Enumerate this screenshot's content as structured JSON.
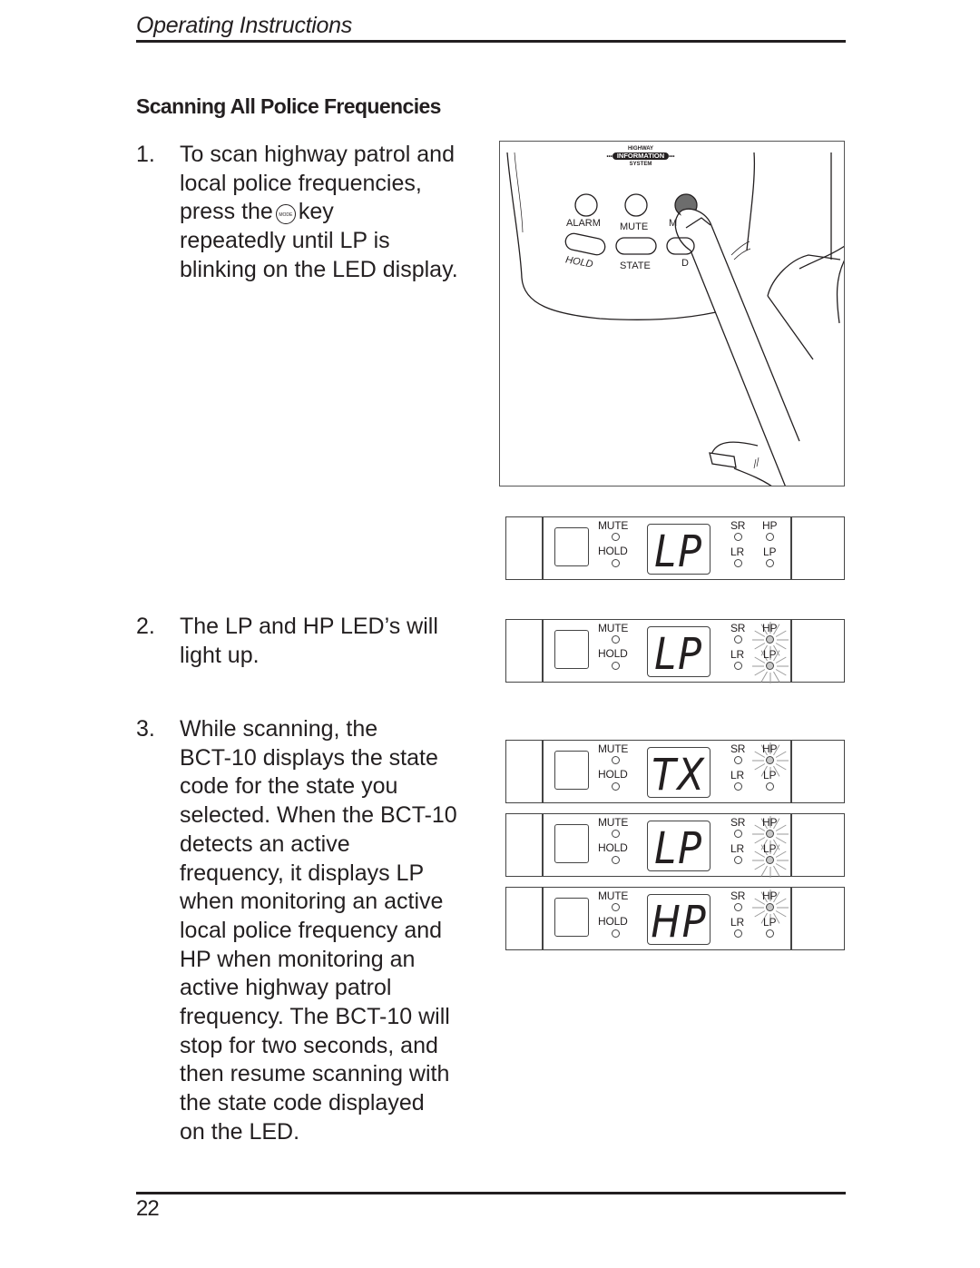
{
  "header": {
    "title": "Operating Instructions"
  },
  "section": {
    "title": "Scanning All Police Frequencies"
  },
  "steps": [
    {
      "number": "1.",
      "text_before_icon": "To scan highway patrol and\nlocal police frequencies,\npress the",
      "icon": "mode-key-icon",
      "icon_label": "MODE",
      "text_after_icon": "key\nrepeatedly until LP is\nblinking on the LED display."
    },
    {
      "number": "2.",
      "text": "The LP and HP LED’s will\nlight up."
    },
    {
      "number": "3.",
      "text": "While scanning, the\nBCT-10 displays the state\ncode for the state you\nselected. When the BCT-10\ndetects an active\nfrequency, it displays LP\nwhen monitoring an active\nlocal police frequency and\nHP when monitoring an\nactive highway patrol\nfrequency. The BCT-10 will\nstop for two seconds, and\nthen resume scanning with\nthe state code displayed\non the LED."
    }
  ],
  "illustration": {
    "logo": {
      "top": "HIGHWAY",
      "middle": "INFORMATION",
      "bottom": "SYSTEM"
    },
    "button_labels": {
      "alarm": "ALARM",
      "mute": "MUTE",
      "mode_partial": "M",
      "hold": "HOLD",
      "state": "STATE",
      "dim_partial": "D"
    }
  },
  "panel_labels": {
    "mute": "MUTE",
    "hold": "HOLD",
    "sr": "SR",
    "hp": "HP",
    "lr": "LR",
    "lp": "LP"
  },
  "panels": [
    {
      "display": "LP",
      "hp_lit": false,
      "lp_lit": false
    },
    {
      "display": "LP",
      "hp_lit": true,
      "lp_lit": true
    },
    {
      "display": "TX",
      "hp_lit": true,
      "lp_lit": false
    },
    {
      "display": "LP",
      "hp_lit": true,
      "lp_lit": true
    },
    {
      "display": "HP",
      "hp_lit": true,
      "lp_lit": false
    }
  ],
  "footer": {
    "page_number": "22"
  }
}
